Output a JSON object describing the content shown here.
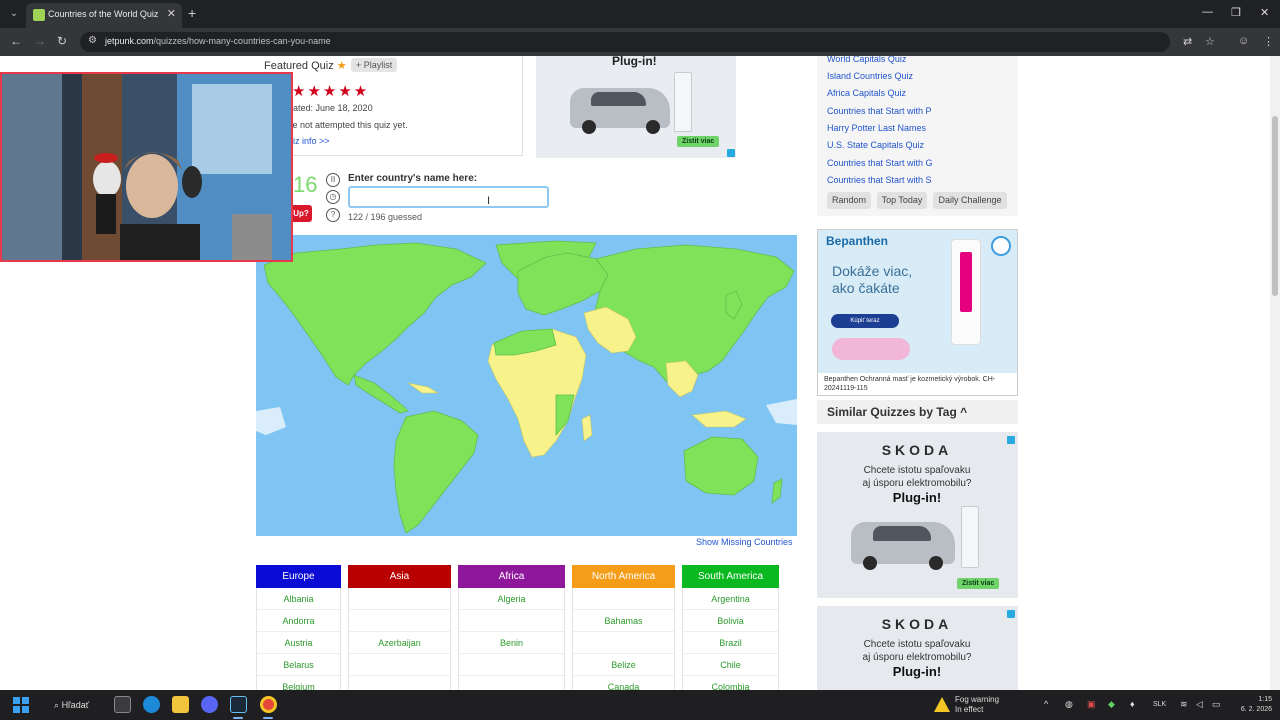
{
  "browser": {
    "tab_title": "Countries of the World Quiz",
    "url_host": "jetpunk.com",
    "url_path": "/quizzes/how-many-countries-can-you-name"
  },
  "quiz": {
    "featured_label": "Featured Quiz",
    "playlist_label": "+ Playlist",
    "rating_stars": "★★★★★",
    "updated": "dated: June 18, 2020",
    "attempted": "ve not attempted this quiz yet.",
    "quiz_info": "uiz info >>",
    "score": "16",
    "give_up": "Up?",
    "enter_label": "Enter country's name here:",
    "answer_value": "",
    "guessed": "122 / 196 guessed",
    "show_missing": "Show Missing Countries"
  },
  "ads": {
    "top_plugin": "Plug-in!",
    "top_cta": "Zistit viac",
    "bep_logo": "Bepanthen",
    "bep_text": "Dokáže viac,\nako čakáte",
    "bep_btn": "Kúpiť teraz",
    "bep_foot": "Bepanthen Ochranná masť je kozmetický výrobok. CH-20241119-115",
    "skoda_logo": "SKODA",
    "skoda_text": "Chcete istotu spaľovaku\naj úsporu elektromobilu?",
    "skoda_plugin": "Plug-in!",
    "skoda_cta": "Zistit viac"
  },
  "sidebar": {
    "links": [
      "World Capitals Quiz",
      "Island Countries Quiz",
      "Africa Capitals Quiz",
      "Countries that Start with P",
      "Harry Potter Last Names",
      "U.S. State Capitals Quiz",
      "Countries that Start with G",
      "Countries that Start with S"
    ],
    "buttons": [
      "Random",
      "Top Today",
      "Daily Challenge"
    ],
    "similar_title": "Similar Quizzes by Tag ^"
  },
  "table": {
    "headers": [
      "Europe",
      "Asia",
      "Africa",
      "North America",
      "South America"
    ],
    "colors": [
      "#0b0bd6",
      "#b90000",
      "#8e179b",
      "#f59d18",
      "#0ab820"
    ],
    "rows": {
      "europe": [
        "Albania",
        "Andorra",
        "Austria",
        "Belarus",
        "Belgium"
      ],
      "asia": [
        "",
        "",
        "Azerbaijan",
        "",
        ""
      ],
      "africa": [
        "Algeria",
        "",
        "Benin",
        "",
        ""
      ],
      "north_america": [
        "",
        "Bahamas",
        "",
        "Belize",
        "Canada"
      ],
      "south_america": [
        "Argentina",
        "Bolivia",
        "Brazil",
        "Chile",
        "Colombia"
      ]
    }
  },
  "taskbar": {
    "search": "Hľadať",
    "fog": "Fog warning\nIn effect",
    "lang": "SLK",
    "clock": "1:15\n6. 2. 2026"
  },
  "map_colors": {
    "ocean": "#7ec5f3",
    "guessed": "#7fe35a",
    "missing": "#f7f28a",
    "ice": "#d9eefa"
  }
}
